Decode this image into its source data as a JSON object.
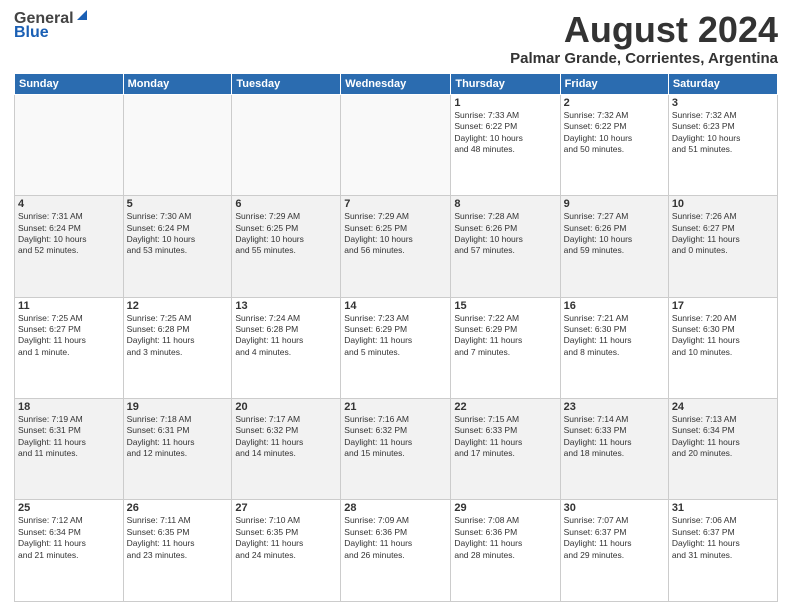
{
  "header": {
    "logo_general": "General",
    "logo_blue": "Blue",
    "month_year": "August 2024",
    "location": "Palmar Grande, Corrientes, Argentina"
  },
  "weekdays": [
    "Sunday",
    "Monday",
    "Tuesday",
    "Wednesday",
    "Thursday",
    "Friday",
    "Saturday"
  ],
  "weeks": [
    [
      {
        "day": "",
        "info": ""
      },
      {
        "day": "",
        "info": ""
      },
      {
        "day": "",
        "info": ""
      },
      {
        "day": "",
        "info": ""
      },
      {
        "day": "1",
        "info": "Sunrise: 7:33 AM\nSunset: 6:22 PM\nDaylight: 10 hours\nand 48 minutes."
      },
      {
        "day": "2",
        "info": "Sunrise: 7:32 AM\nSunset: 6:22 PM\nDaylight: 10 hours\nand 50 minutes."
      },
      {
        "day": "3",
        "info": "Sunrise: 7:32 AM\nSunset: 6:23 PM\nDaylight: 10 hours\nand 51 minutes."
      }
    ],
    [
      {
        "day": "4",
        "info": "Sunrise: 7:31 AM\nSunset: 6:24 PM\nDaylight: 10 hours\nand 52 minutes."
      },
      {
        "day": "5",
        "info": "Sunrise: 7:30 AM\nSunset: 6:24 PM\nDaylight: 10 hours\nand 53 minutes."
      },
      {
        "day": "6",
        "info": "Sunrise: 7:29 AM\nSunset: 6:25 PM\nDaylight: 10 hours\nand 55 minutes."
      },
      {
        "day": "7",
        "info": "Sunrise: 7:29 AM\nSunset: 6:25 PM\nDaylight: 10 hours\nand 56 minutes."
      },
      {
        "day": "8",
        "info": "Sunrise: 7:28 AM\nSunset: 6:26 PM\nDaylight: 10 hours\nand 57 minutes."
      },
      {
        "day": "9",
        "info": "Sunrise: 7:27 AM\nSunset: 6:26 PM\nDaylight: 10 hours\nand 59 minutes."
      },
      {
        "day": "10",
        "info": "Sunrise: 7:26 AM\nSunset: 6:27 PM\nDaylight: 11 hours\nand 0 minutes."
      }
    ],
    [
      {
        "day": "11",
        "info": "Sunrise: 7:25 AM\nSunset: 6:27 PM\nDaylight: 11 hours\nand 1 minute."
      },
      {
        "day": "12",
        "info": "Sunrise: 7:25 AM\nSunset: 6:28 PM\nDaylight: 11 hours\nand 3 minutes."
      },
      {
        "day": "13",
        "info": "Sunrise: 7:24 AM\nSunset: 6:28 PM\nDaylight: 11 hours\nand 4 minutes."
      },
      {
        "day": "14",
        "info": "Sunrise: 7:23 AM\nSunset: 6:29 PM\nDaylight: 11 hours\nand 5 minutes."
      },
      {
        "day": "15",
        "info": "Sunrise: 7:22 AM\nSunset: 6:29 PM\nDaylight: 11 hours\nand 7 minutes."
      },
      {
        "day": "16",
        "info": "Sunrise: 7:21 AM\nSunset: 6:30 PM\nDaylight: 11 hours\nand 8 minutes."
      },
      {
        "day": "17",
        "info": "Sunrise: 7:20 AM\nSunset: 6:30 PM\nDaylight: 11 hours\nand 10 minutes."
      }
    ],
    [
      {
        "day": "18",
        "info": "Sunrise: 7:19 AM\nSunset: 6:31 PM\nDaylight: 11 hours\nand 11 minutes."
      },
      {
        "day": "19",
        "info": "Sunrise: 7:18 AM\nSunset: 6:31 PM\nDaylight: 11 hours\nand 12 minutes."
      },
      {
        "day": "20",
        "info": "Sunrise: 7:17 AM\nSunset: 6:32 PM\nDaylight: 11 hours\nand 14 minutes."
      },
      {
        "day": "21",
        "info": "Sunrise: 7:16 AM\nSunset: 6:32 PM\nDaylight: 11 hours\nand 15 minutes."
      },
      {
        "day": "22",
        "info": "Sunrise: 7:15 AM\nSunset: 6:33 PM\nDaylight: 11 hours\nand 17 minutes."
      },
      {
        "day": "23",
        "info": "Sunrise: 7:14 AM\nSunset: 6:33 PM\nDaylight: 11 hours\nand 18 minutes."
      },
      {
        "day": "24",
        "info": "Sunrise: 7:13 AM\nSunset: 6:34 PM\nDaylight: 11 hours\nand 20 minutes."
      }
    ],
    [
      {
        "day": "25",
        "info": "Sunrise: 7:12 AM\nSunset: 6:34 PM\nDaylight: 11 hours\nand 21 minutes."
      },
      {
        "day": "26",
        "info": "Sunrise: 7:11 AM\nSunset: 6:35 PM\nDaylight: 11 hours\nand 23 minutes."
      },
      {
        "day": "27",
        "info": "Sunrise: 7:10 AM\nSunset: 6:35 PM\nDaylight: 11 hours\nand 24 minutes."
      },
      {
        "day": "28",
        "info": "Sunrise: 7:09 AM\nSunset: 6:36 PM\nDaylight: 11 hours\nand 26 minutes."
      },
      {
        "day": "29",
        "info": "Sunrise: 7:08 AM\nSunset: 6:36 PM\nDaylight: 11 hours\nand 28 minutes."
      },
      {
        "day": "30",
        "info": "Sunrise: 7:07 AM\nSunset: 6:37 PM\nDaylight: 11 hours\nand 29 minutes."
      },
      {
        "day": "31",
        "info": "Sunrise: 7:06 AM\nSunset: 6:37 PM\nDaylight: 11 hours\nand 31 minutes."
      }
    ]
  ]
}
